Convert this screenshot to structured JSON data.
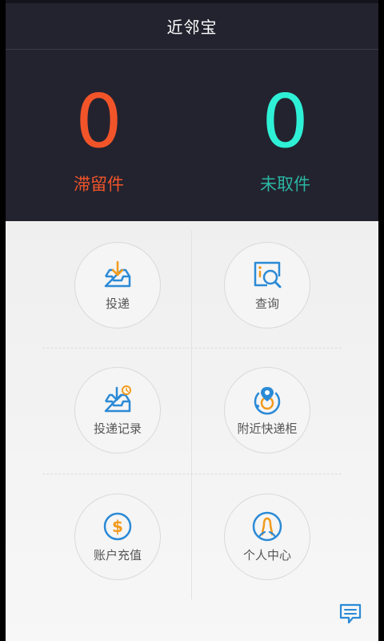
{
  "header": {
    "title": "近邻宝"
  },
  "stats": {
    "stranded": {
      "value": "0",
      "label": "滞留件"
    },
    "unpicked": {
      "value": "0",
      "label": "未取件"
    }
  },
  "menu": {
    "deliver": {
      "label": "投递",
      "icon": "tray-download-icon"
    },
    "query": {
      "label": "查询",
      "icon": "search-icon"
    },
    "delivery_records": {
      "label": "投递记录",
      "icon": "tray-clock-icon"
    },
    "nearby_lockers": {
      "label": "附近快递柜",
      "icon": "location-pin-icon"
    },
    "recharge": {
      "label": "账户充值",
      "icon": "dollar-coin-icon"
    },
    "profile": {
      "label": "个人中心",
      "icon": "user-icon"
    }
  },
  "colors": {
    "header_bg": "#23232f",
    "stranded": "#f2542a",
    "unpicked": "#2ef0d6",
    "icon_blue": "#2b8ad6",
    "icon_orange": "#f29a1d"
  },
  "footer": {
    "message_icon": "chat-bubble-icon"
  }
}
